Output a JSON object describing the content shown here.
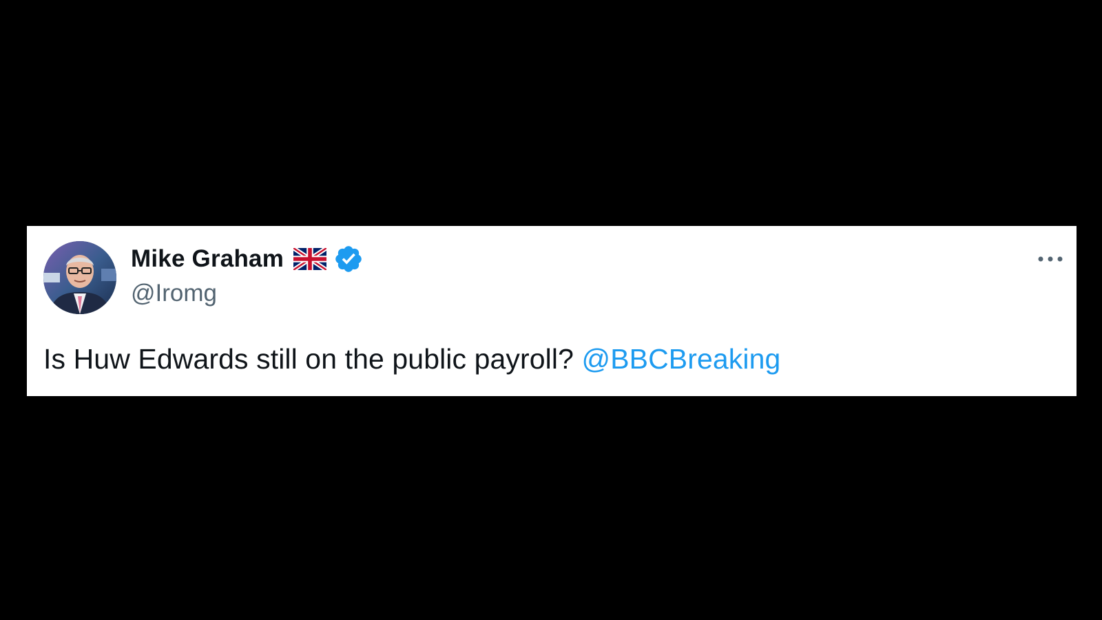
{
  "tweet": {
    "author": {
      "display_name": "Mike Graham",
      "handle": "@Iromg",
      "flag_icon": "uk-flag-icon",
      "verified_icon": "verified-badge-icon",
      "avatar": "avatar"
    },
    "text": "Is Huw Edwards still on the public payroll? ",
    "mention": "@BBCBreaking",
    "more_icon": "more-options-icon"
  },
  "colors": {
    "page_background": "#000000",
    "card_background": "#ffffff",
    "text_primary": "#0f1419",
    "text_secondary": "#536471",
    "accent": "#1d9bf0"
  }
}
